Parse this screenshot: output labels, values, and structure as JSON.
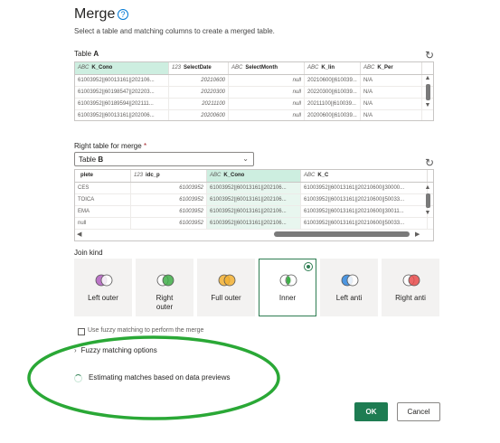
{
  "dialog": {
    "title": "Merge",
    "help_icon": "?",
    "subtitle": "Select a table and matching columns to create a merged table."
  },
  "table_a": {
    "label_prefix": "Table ",
    "label_bold": "A",
    "headers": [
      {
        "type": "ABC",
        "name": "K_Cono"
      },
      {
        "type": "123",
        "name": "SelectDate"
      },
      {
        "type": "ABC",
        "name": "SelectMonth"
      },
      {
        "type": "ABC",
        "name": "K_lin"
      },
      {
        "type": "ABC",
        "name": "K_Per"
      }
    ],
    "rows": [
      [
        "61003952||60013161||202106...",
        "20210600",
        "null",
        "20210600||610039...",
        "N/A"
      ],
      [
        "61003952||60198547||202203...",
        "20220300",
        "null",
        "20220300||610039...",
        "N/A"
      ],
      [
        "61003952||60189594||202111...",
        "20211100",
        "null",
        "20211100||610039...",
        "N/A"
      ],
      [
        "61003952||60013161||202006...",
        "20200600",
        "null",
        "20200600||610039...",
        "N/A"
      ]
    ]
  },
  "right_table": {
    "label": "Right table for merge",
    "required_mark": "*",
    "selected_prefix": "Table ",
    "selected_bold": "B",
    "headers": [
      {
        "type": "",
        "name": "plete"
      },
      {
        "type": "123",
        "name": "idc_p"
      },
      {
        "type": "ABC",
        "name": "K_Cono"
      },
      {
        "type": "ABC",
        "name": "K_C"
      }
    ],
    "rows": [
      [
        "CES",
        "61003952",
        "61003952||60013161||202106...",
        "61003952||60013161||20210600||30000..."
      ],
      [
        "TOICA",
        "61003952",
        "61003952||60013161||202106...",
        "61003952||60013161||20210600||50033..."
      ],
      [
        "EMA",
        "61003952",
        "61003952||60013161||202106...",
        "61003952||60013161||20210600||30011..."
      ],
      [
        "null",
        "61003952",
        "61003952||60013161||202106...",
        "61003952||60013161||20210600||50033..."
      ]
    ]
  },
  "join_kind": {
    "label": "Join kind",
    "options": [
      {
        "label": "Left outer",
        "icon": "venn-left-outer-icon",
        "c1": "#b05fc0",
        "c2": "#ffffff",
        "fill": "left"
      },
      {
        "label": "Right outer",
        "icon": "venn-right-outer-icon",
        "c1": "#ffffff",
        "c2": "#3fae49",
        "fill": "right"
      },
      {
        "label": "Full outer",
        "icon": "venn-full-outer-icon",
        "c1": "#f2b134",
        "c2": "#f2b134",
        "fill": "both"
      },
      {
        "label": "Inner",
        "icon": "venn-inner-icon",
        "c1": "#ffffff",
        "c2": "#ffffff",
        "fill": "inner"
      },
      {
        "label": "Left anti",
        "icon": "venn-left-anti-icon",
        "c1": "#2e86de",
        "c2": "#ffffff",
        "fill": "leftanti"
      },
      {
        "label": "Right anti",
        "icon": "venn-right-anti-icon",
        "c1": "#ffffff",
        "c2": "#e84c4c",
        "fill": "rightanti"
      }
    ],
    "selected": "Inner"
  },
  "fuzzy": {
    "checkbox_label": "Use fuzzy matching to perform the merge",
    "options_label": "Fuzzy matching options"
  },
  "status": {
    "estimating": "Estimating matches based on data previews"
  },
  "footer": {
    "ok_label": "OK",
    "cancel_label": "Cancel"
  },
  "colors": {
    "accent": "#1e7c52",
    "selected_column": "#cdeee0",
    "annotation_ellipse": "#2aa836"
  }
}
